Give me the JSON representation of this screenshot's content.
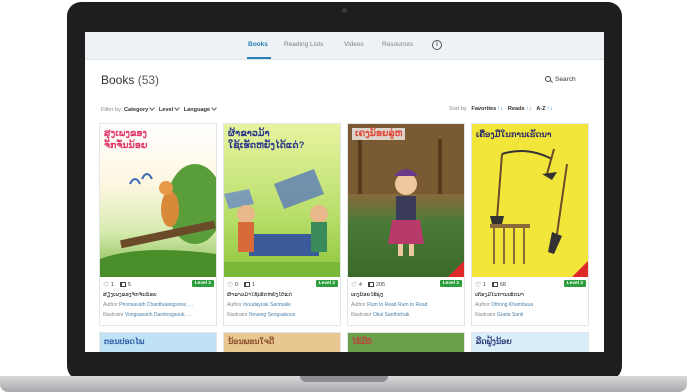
{
  "nav": {
    "tabs": [
      {
        "label": "Books"
      },
      {
        "label": "Reading Lists"
      },
      {
        "label": "Videos"
      },
      {
        "label": "Resources"
      }
    ],
    "info_label": "i"
  },
  "page": {
    "title": "Books",
    "count": "(53)",
    "search_label": "Search"
  },
  "filters": {
    "label": "Filter by",
    "category": "Category",
    "level": "Level",
    "language": "Language"
  },
  "sort": {
    "label": "Sort by",
    "favorites": "Favorites",
    "reads": "Reads",
    "az": "A-Z",
    "arrows": "↑↓"
  },
  "books": [
    {
      "cover_title": "ສຸງເພງຂອງ\nຈັກຈັ່ນນ້ອຍ",
      "cover_title_color": "#e23a6a",
      "likes": "1",
      "reads": "5",
      "level": "Level 2",
      "title": "ສຽງເພງຂອງຈັກຈັ່ນນ້ອຍ",
      "author_prefix": "Author",
      "author": "Phonsavath Chanthalangsone, ...",
      "illus_prefix": "Illustrator",
      "illustrator": "Vongsavanh Damlongsouk, ..."
    },
    {
      "cover_title": "ຜ້າຂາວມ້າ\nໃຊ້ເຮັດຫຍັງໄດ້ແດ່?",
      "cover_title_color": "#2e3a8a",
      "likes": "0",
      "reads": "1",
      "level": "Level 2",
      "title": "ຜ້າຂາວມ້າໃຊ້ເຮັດຫຍັງໄດ້ແດ່",
      "author_prefix": "Author",
      "author": "Inoudayvak Sanmalie",
      "illus_prefix": "Illustrator",
      "illustrator": "Noveng Sengsakoun"
    },
    {
      "cover_title": "ເຄງນ້ອຍລູ່ຫ",
      "cover_title_color": "#e04a3a",
      "likes": "4",
      "reads": "205",
      "level": "Level 2",
      "title": "ເຄງນ້ອຍໄຮ້ພຸ່ງ",
      "author_prefix": "Author",
      "author": "Rum to Read Rum to Read",
      "illus_prefix": "Illustrator",
      "illustrator": "Okul Santhichak"
    },
    {
      "cover_title": "ເຄື່ອງມືໃນການເຮັດນາ",
      "cover_title_color": "#2a2a6a",
      "likes": "1",
      "reads": "68",
      "level": "Level 2",
      "title": "ເຄື່ອງມືໃນການເຮັດນາ",
      "author_prefix": "Author",
      "author": "Othong Khambuua",
      "illus_prefix": "Illustrator",
      "illustrator": "Gueta Santi"
    }
  ],
  "next_row": [
    {
      "cover_title": "ຕອນປອດໄພ",
      "color": "#2e5fa8"
    },
    {
      "cover_title": "ນ້ອນພອນໃຈດີ",
      "color": "#8a4a2a"
    },
    {
      "cover_title": "ໄຮ້ມີບໍ່",
      "color": "#c23a3a"
    },
    {
      "cover_title": "ລີດຟູ້ງນ້ອຍ",
      "color": "#2a3a7a"
    }
  ],
  "colors": {
    "accent": "#2a7fb8",
    "level_badge": "#2e9e3e",
    "bezel": "#1e1e20"
  }
}
